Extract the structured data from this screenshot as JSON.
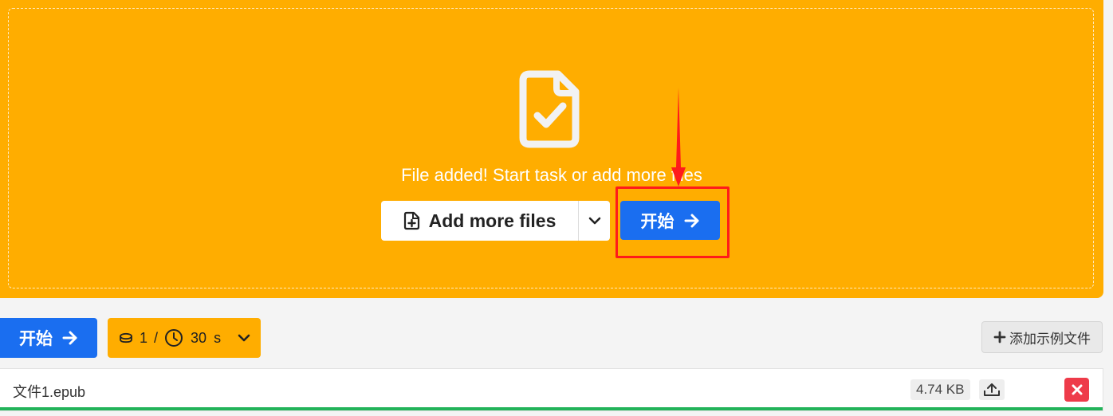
{
  "dropzone": {
    "message": "File added! Start task or add more files",
    "add_more_label": "Add more files",
    "start_label": "开始",
    "file_icon": "file-check-icon",
    "annotation_color": "#ff1a1a"
  },
  "toolbar": {
    "start_label": "开始",
    "credits_value": "1",
    "credits_separator": "/",
    "time_value": "30",
    "time_unit": "s",
    "add_example_label": "添加示例文件"
  },
  "files": [
    {
      "name": "文件1.epub",
      "size": "4.74 KB",
      "progress_percent": 100
    }
  ],
  "colors": {
    "accent_orange": "#ffad00",
    "primary_blue": "#1a6ef0",
    "danger_red": "#ee3b4a",
    "progress_green": "#22b35a"
  }
}
